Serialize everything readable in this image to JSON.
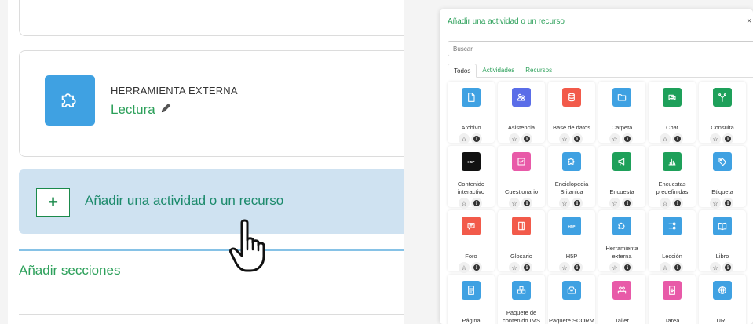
{
  "course_page": {
    "tool": {
      "type": "HERRAMIENTA EXTERNA",
      "name": "Lectura",
      "icon": "puzzle-icon",
      "edit_icon": "pencil-icon"
    },
    "add_activity": {
      "plus_label": "+",
      "link_text": "Añadir una actividad o un recurso"
    },
    "add_sections": "Añadir secciones"
  },
  "modal": {
    "title": "Añadir una actividad o un recurso",
    "close": "×",
    "search_placeholder": "Buscar",
    "tabs": [
      {
        "label": "Todos",
        "active": true
      },
      {
        "label": "Actividades",
        "active": false
      },
      {
        "label": "Recursos",
        "active": false
      }
    ],
    "items": [
      {
        "label": "Archivo",
        "icon": "file-icon",
        "color": "#3fa1e2"
      },
      {
        "label": "Asistencia",
        "icon": "attendance-icon",
        "color": "#5a6de8"
      },
      {
        "label": "Base de datos",
        "icon": "database-icon",
        "color": "#f25a4a"
      },
      {
        "label": "Carpeta",
        "icon": "folder-icon",
        "color": "#3fa1e2"
      },
      {
        "label": "Chat",
        "icon": "chat-icon",
        "color": "#1ea05a"
      },
      {
        "label": "Consulta",
        "icon": "choice-icon",
        "color": "#1ea05a"
      },
      {
        "label": "Contenido interactivo",
        "icon": "h5p-icon",
        "color": "#111111"
      },
      {
        "label": "Cuestionario",
        "icon": "quiz-icon",
        "color": "#e85aa8"
      },
      {
        "label": "Enciclopedia Britanica",
        "icon": "puzzle-icon",
        "color": "#3fa1e2"
      },
      {
        "label": "Encuesta",
        "icon": "megaphone-icon",
        "color": "#1ea05a"
      },
      {
        "label": "Encuestas predefinidas",
        "icon": "bar-chart-icon",
        "color": "#1ea05a"
      },
      {
        "label": "Etiqueta",
        "icon": "tag-icon",
        "color": "#3fa1e2"
      },
      {
        "label": "Foro",
        "icon": "forum-icon",
        "color": "#f25a4a"
      },
      {
        "label": "Glosario",
        "icon": "glossary-icon",
        "color": "#f25a4a"
      },
      {
        "label": "H5P",
        "icon": "h5p-icon",
        "color": "#3fa1e2"
      },
      {
        "label": "Herramienta externa",
        "icon": "puzzle-icon",
        "color": "#3fa1e2"
      },
      {
        "label": "Lección",
        "icon": "lesson-icon",
        "color": "#3fa1e2"
      },
      {
        "label": "Libro",
        "icon": "book-icon",
        "color": "#3fa1e2"
      },
      {
        "label": "Página",
        "icon": "page-icon",
        "color": "#3fa1e2"
      },
      {
        "label": "Paquete de contenido IMS",
        "icon": "ims-package-icon",
        "color": "#3fa1e2"
      },
      {
        "label": "Paquete SCORM",
        "icon": "scorm-icon",
        "color": "#3fa1e2"
      },
      {
        "label": "Taller",
        "icon": "workshop-icon",
        "color": "#e85aa8"
      },
      {
        "label": "Tarea",
        "icon": "assignment-icon",
        "color": "#e85aa8"
      },
      {
        "label": "URL",
        "icon": "globe-icon",
        "color": "#3fa1e2"
      }
    ],
    "star_glyph": "☆",
    "info_glyph": "i"
  }
}
